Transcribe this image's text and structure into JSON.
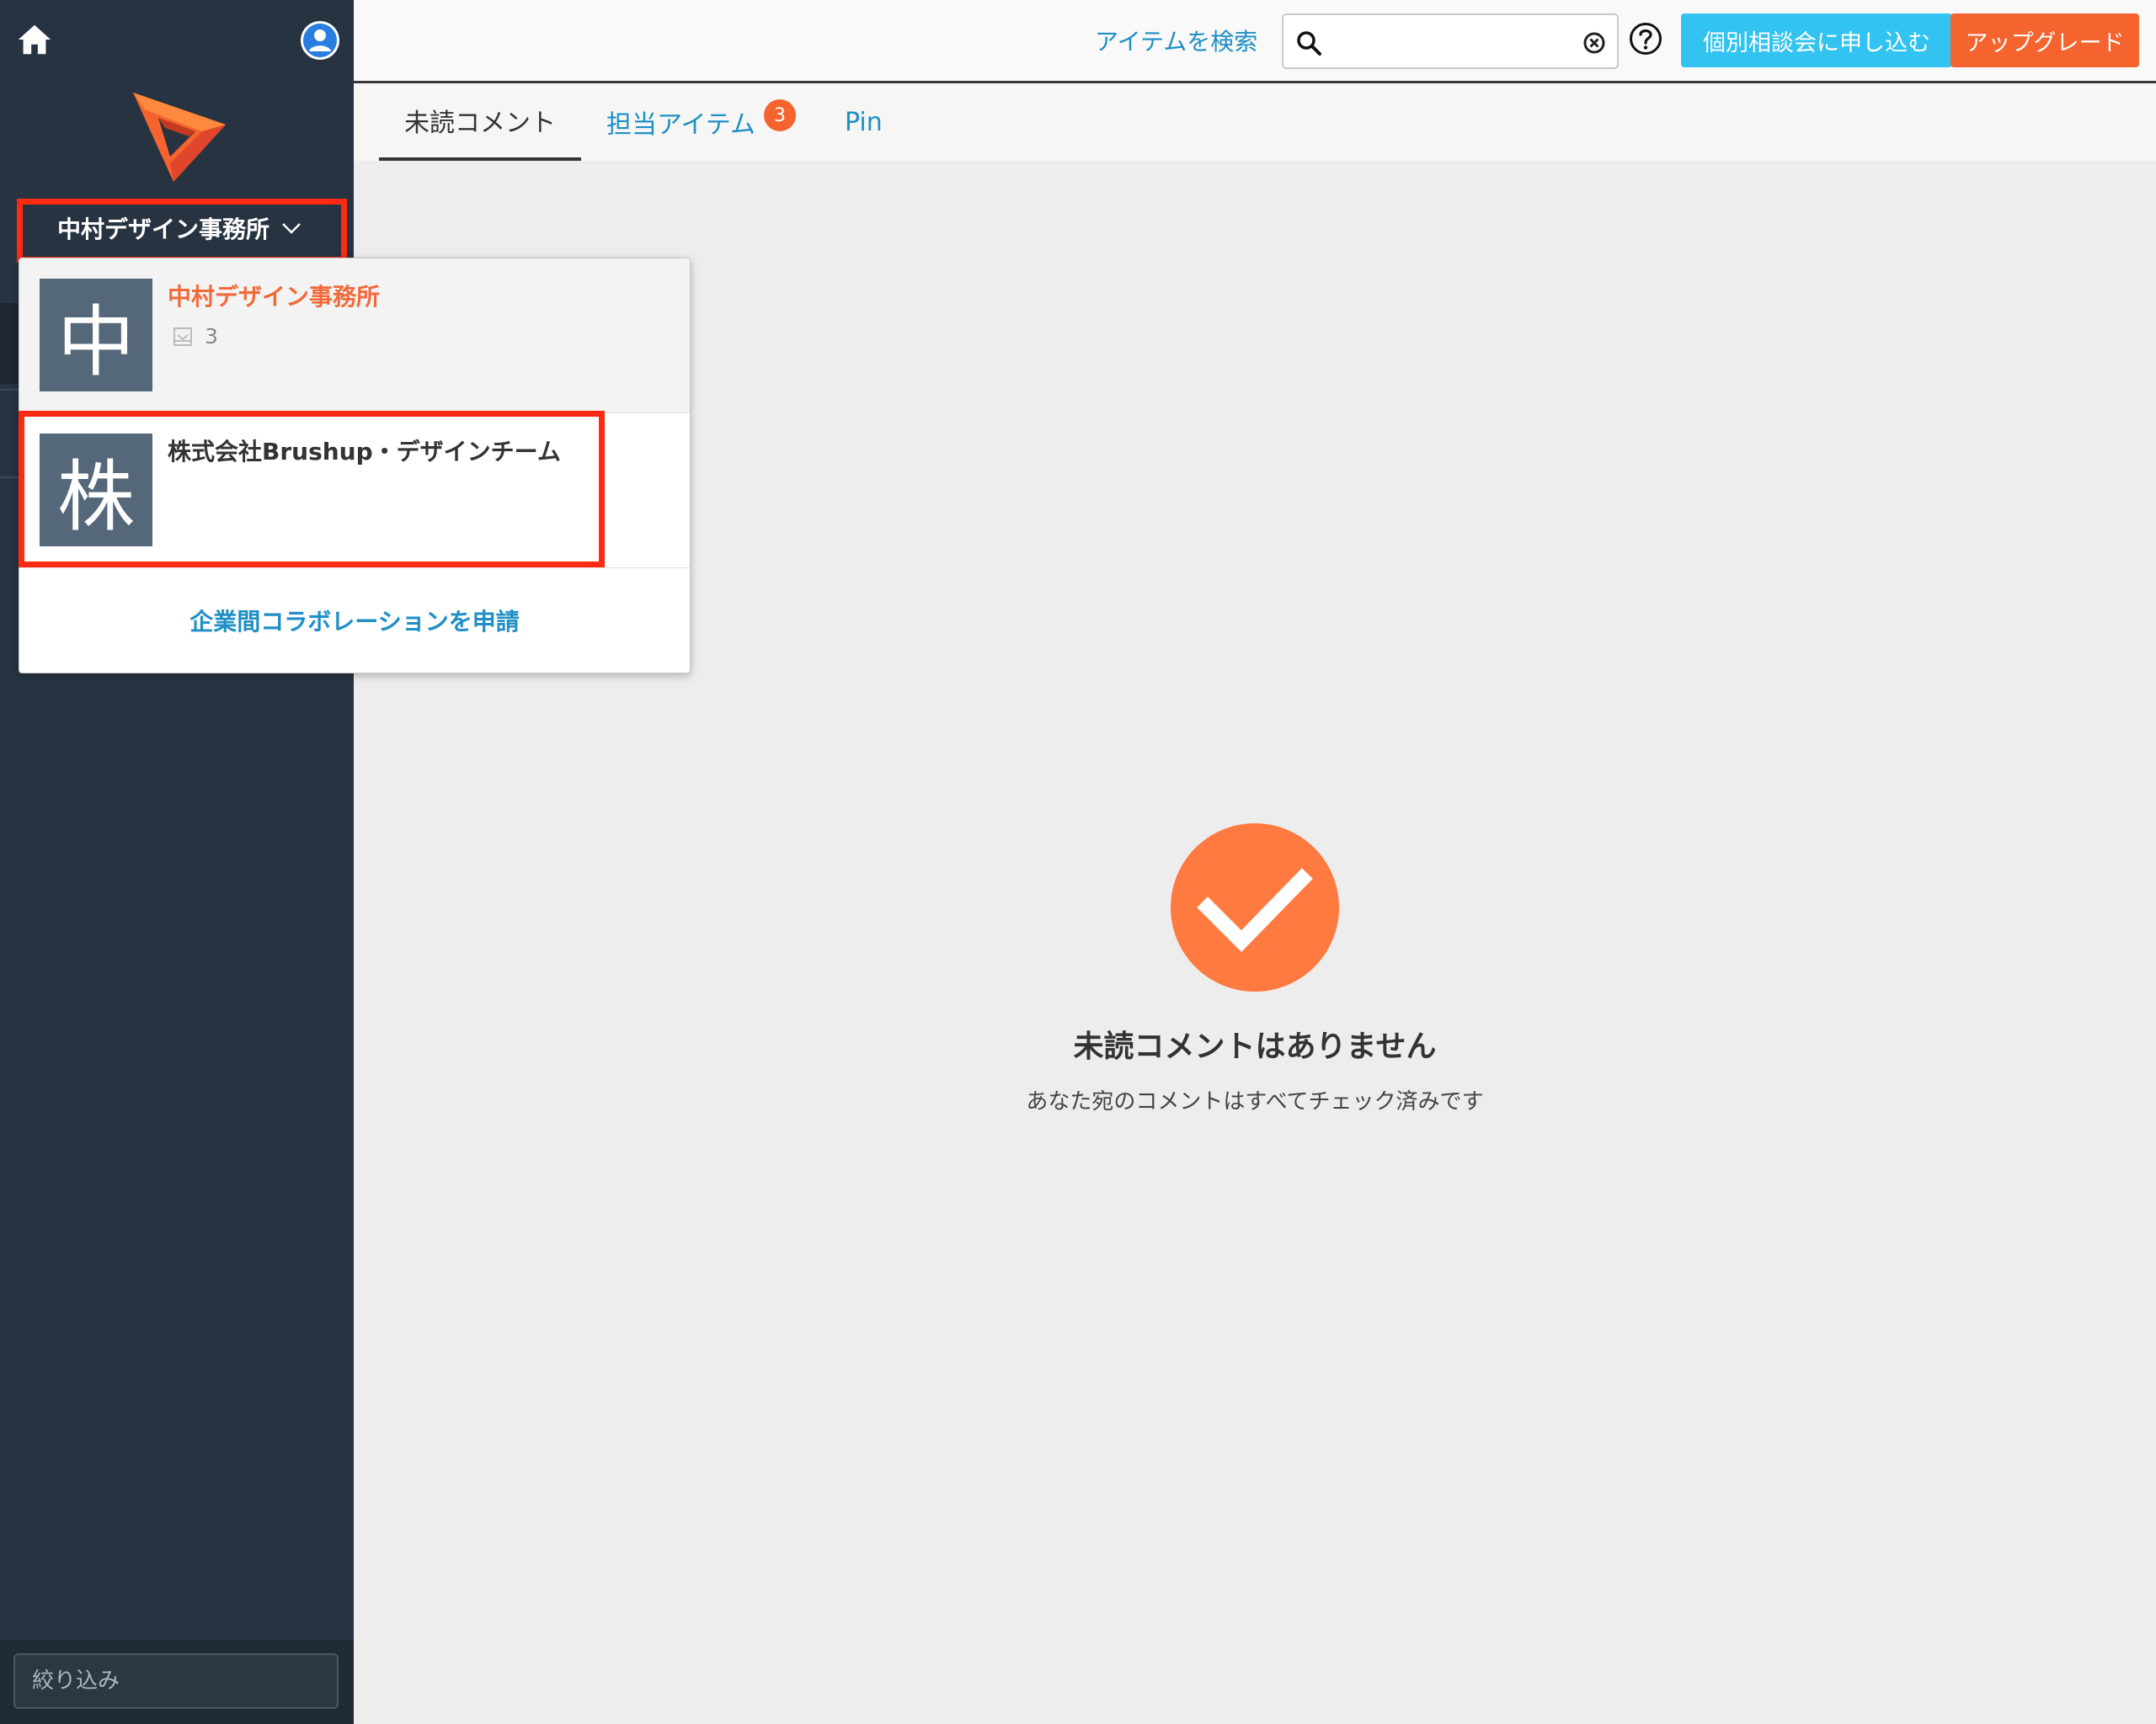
{
  "colors": {
    "sidebar_bg": "#273341",
    "accent_orange": "#f5632e",
    "accent_cyan": "#33c3f0",
    "link_blue": "#1f8fc6",
    "highlight_red": "#ff2a12"
  },
  "icons": {
    "home": "home-icon",
    "user": "user-avatar-icon",
    "logo": "brushup-logo",
    "search": "search-icon",
    "clear": "clear-icon",
    "help": "help-icon",
    "check": "check-icon",
    "inbox": "inbox-icon"
  },
  "sidebar": {
    "org_switcher_label": "中村デザイン事務所",
    "filter_placeholder": "絞り込み"
  },
  "topbar": {
    "search_link": "アイテムを検索",
    "search_value": "",
    "consult_button": "個別相談会に申し込む",
    "upgrade_button": "アップグレード"
  },
  "tabs": [
    {
      "label": "未読コメント",
      "active": true
    },
    {
      "label": "担当アイテム",
      "badge": "3"
    },
    {
      "label": "Pin"
    }
  ],
  "empty_state": {
    "title": "未読コメントはありません",
    "subtitle": "あなた宛のコメントはすべてチェック済みです"
  },
  "dropdown": {
    "orgs": [
      {
        "avatar": "中",
        "name": "中村デザイン事務所",
        "count": "3",
        "active": true
      },
      {
        "avatar": "株",
        "name": "株式会社Brushup・デザインチーム"
      }
    ],
    "collab_link": "企業間コラボレーションを申請"
  }
}
